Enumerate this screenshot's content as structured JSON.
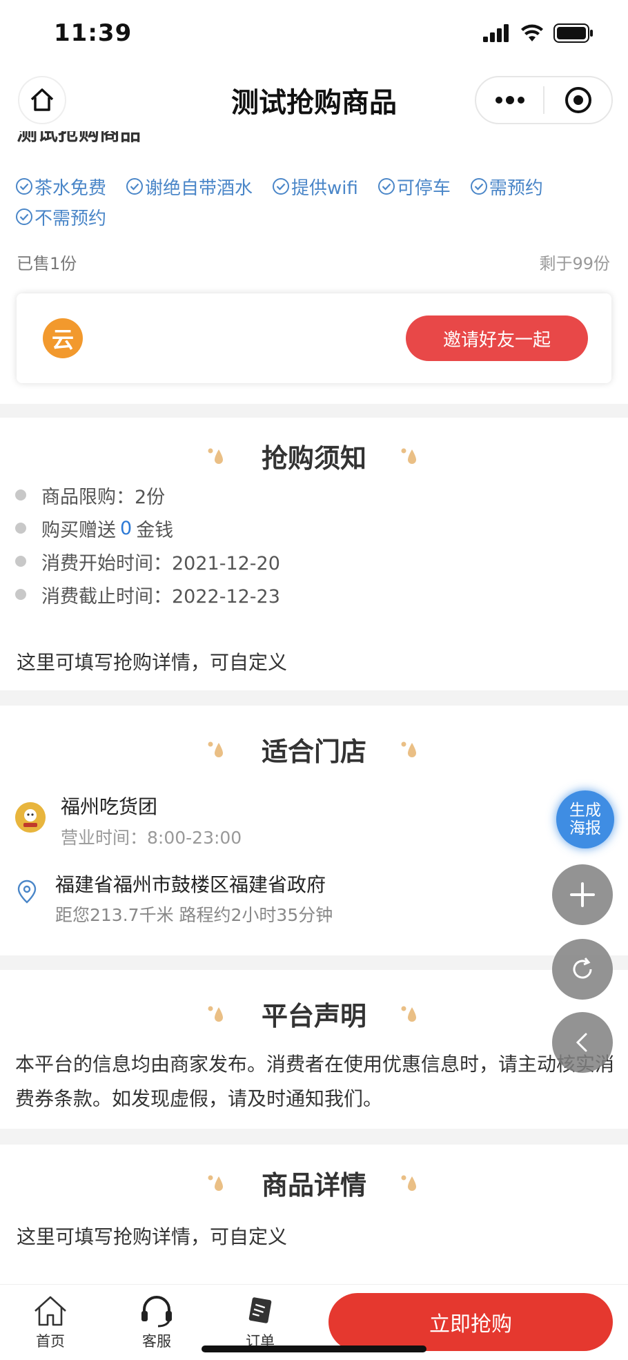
{
  "status_bar": {
    "time": "11:39"
  },
  "nav": {
    "title": "测试抢购商品"
  },
  "product": {
    "title_cut": "测试抢购商品",
    "tags": [
      "茶水免费",
      "谢绝自带酒水",
      "提供wifi",
      "可停车",
      "需预约",
      "不需预约"
    ],
    "sold": "已售1份",
    "remaining": "剩于99份",
    "invite_icon_text": "云",
    "invite_label": "邀请好友一起"
  },
  "notice": {
    "title": "抢购须知",
    "limit": "商品限购：2份",
    "gift_prefix": "购买赠送",
    "gift_value": "0",
    "gift_suffix": "金钱",
    "start": "消费开始时间：2021-12-20",
    "end": "消费截止时间：2022-12-23",
    "detail": "这里可填写抢购详情，可自定义"
  },
  "stores": {
    "title": "适合门店",
    "name": "福州吃货团",
    "hours": "营业时间：8:00-23:00",
    "address": "福建省福州市鼓楼区福建省政府",
    "distance": "距您213.7千米 路程约2小时35分钟"
  },
  "declaration": {
    "title": "平台声明",
    "text": "本平台的信息均由商家发布。消费者在使用优惠信息时，请主动核实消费券条款。如发现虚假，请及时通知我们。"
  },
  "details": {
    "title": "商品详情",
    "text": "这里可填写抢购详情，可自定义"
  },
  "floating": {
    "poster_label": "生成海报"
  },
  "bottom": {
    "home": "首页",
    "service": "客服",
    "orders": "订单",
    "buy": "立即抢购"
  },
  "colors": {
    "accent_red": "#e5382f",
    "tag_blue": "#4a86c8",
    "poster_blue": "#3f8de3"
  }
}
